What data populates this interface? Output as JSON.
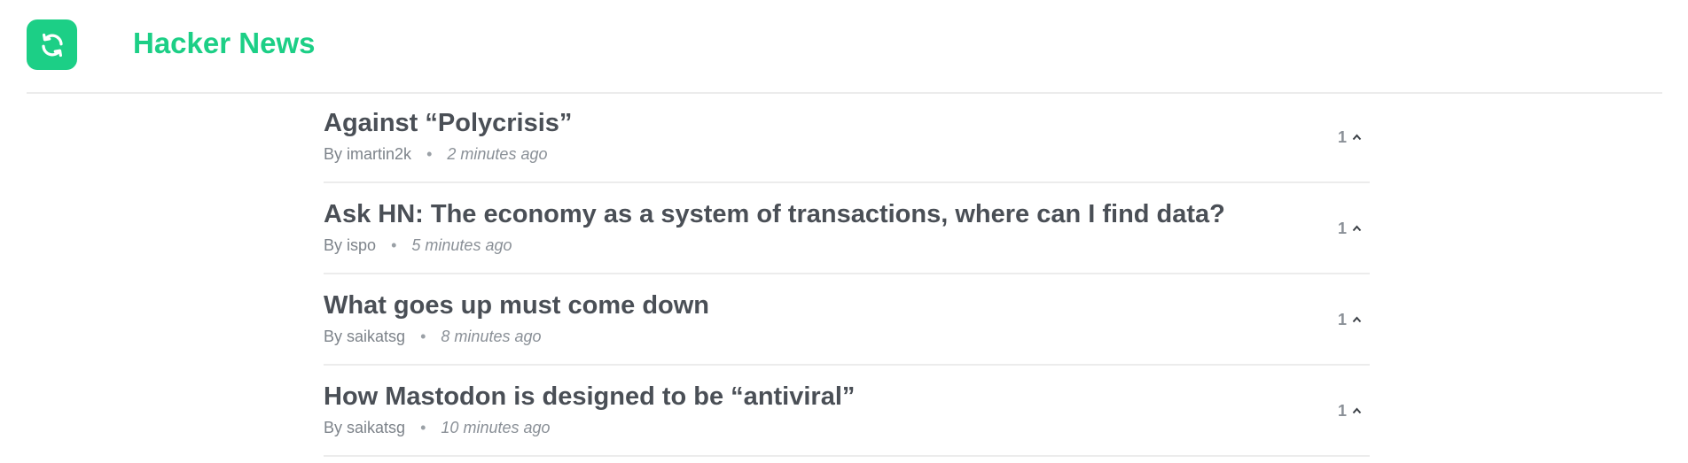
{
  "header": {
    "title": "Hacker News",
    "refresh_icon": "refresh-icon",
    "accent_color": "#1ccf86"
  },
  "stories": [
    {
      "title": "Against “Polycrisis”",
      "by_prefix": "By",
      "author": "imartin2k",
      "separator": "•",
      "time": "2 minutes ago",
      "score": "1",
      "upvote_icon": "chevron-up-icon"
    },
    {
      "title": "Ask HN: The economy as a system of transactions, where can I find data?",
      "by_prefix": "By",
      "author": "ispo",
      "separator": "•",
      "time": "5 minutes ago",
      "score": "1",
      "upvote_icon": "chevron-up-icon"
    },
    {
      "title": "What goes up must come down",
      "by_prefix": "By",
      "author": "saikatsg",
      "separator": "•",
      "time": "8 minutes ago",
      "score": "1",
      "upvote_icon": "chevron-up-icon"
    },
    {
      "title": "How Mastodon is designed to be “antiviral”",
      "by_prefix": "By",
      "author": "saikatsg",
      "separator": "•",
      "time": "10 minutes ago",
      "score": "1",
      "upvote_icon": "chevron-up-icon"
    }
  ]
}
